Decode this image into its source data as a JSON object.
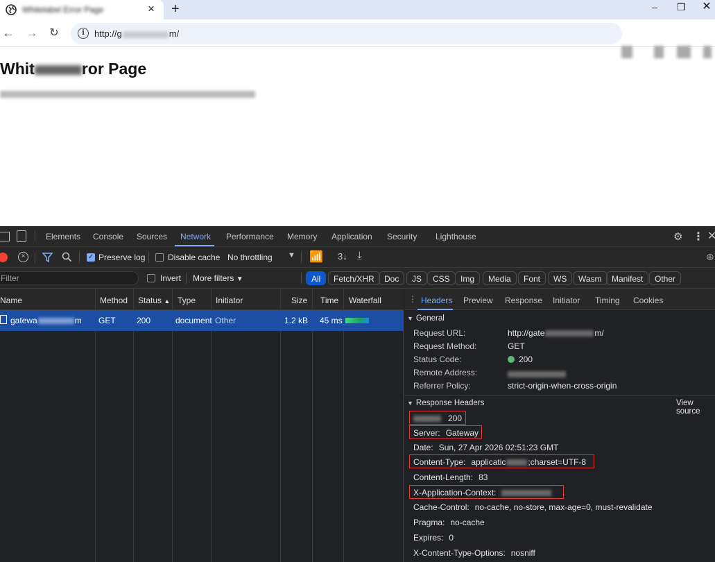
{
  "browser": {
    "tab_title": "Whitelabel Error Page",
    "tab_close": "×",
    "new_tab": "+",
    "url_prefix": "http://g",
    "url_suffix": "m/",
    "window_min": "–",
    "window_max": "❐",
    "window_close": "✕"
  },
  "page": {
    "title_start": "Whit",
    "title_end": "ror Page"
  },
  "devtools": {
    "tabs": [
      "Elements",
      "Console",
      "Sources",
      "Network",
      "Performance",
      "Memory",
      "Application",
      "Security",
      "Lighthouse"
    ],
    "active_tab": "Network",
    "toolbar": {
      "preserve_log": "Preserve log",
      "disable_cache": "Disable cache",
      "throttling": "No throttling"
    },
    "filter": {
      "placeholder": "Filter",
      "invert": "Invert",
      "more_filters": "More filters"
    },
    "type_chips": [
      "All",
      "Fetch/XHR",
      "Doc",
      "JS",
      "CSS",
      "Img",
      "Media",
      "Font",
      "WS",
      "Wasm",
      "Manifest",
      "Other"
    ],
    "columns": [
      "Name",
      "Method",
      "Status",
      "Type",
      "Initiator",
      "Size",
      "Time",
      "Waterfall"
    ],
    "request": {
      "name_start": "gatewa",
      "name_end": "m",
      "method": "GET",
      "status": "200",
      "type": "document",
      "initiator": "Other",
      "size": "1.2 kB",
      "time": "45 ms"
    },
    "detail_tabs": [
      "Headers",
      "Preview",
      "Response",
      "Initiator",
      "Timing",
      "Cookies"
    ],
    "general": {
      "heading": "General",
      "rows": [
        {
          "key": "Request URL:",
          "value_start": "http://gate",
          "value_end": "m/"
        },
        {
          "key": "Request Method:",
          "value": "GET"
        },
        {
          "key": "Status Code:",
          "value": "200"
        },
        {
          "key": "Remote Address:",
          "value": ""
        },
        {
          "key": "Referrer Policy:",
          "value": "strict-origin-when-cross-origin"
        }
      ]
    },
    "response_headers": {
      "heading": "Response Headers",
      "view_source": "View source",
      "status_value": "200",
      "server_key": "Server:",
      "server_value": "Gateway",
      "date_key": "Date:",
      "date_value": "Sun, 27 Apr 2026 02:51:23 GMT",
      "content_type_key": "Content-Type:",
      "content_type_start": "applicatic",
      "content_type_end": ";charset=UTF-8",
      "content_length_key": "Content-Length:",
      "content_length_value": "83",
      "x_app_context_key": "X-Application-Context:",
      "cache_control_key": "Cache-Control:",
      "cache_control_value": "no-cache, no-store, max-age=0, must-revalidate",
      "pragma_key": "Pragma:",
      "pragma_value": "no-cache",
      "expires_key": "Expires:",
      "expires_value": "0",
      "xcto_key": "X-Content-Type-Options:",
      "xcto_value": "nosniff"
    }
  }
}
